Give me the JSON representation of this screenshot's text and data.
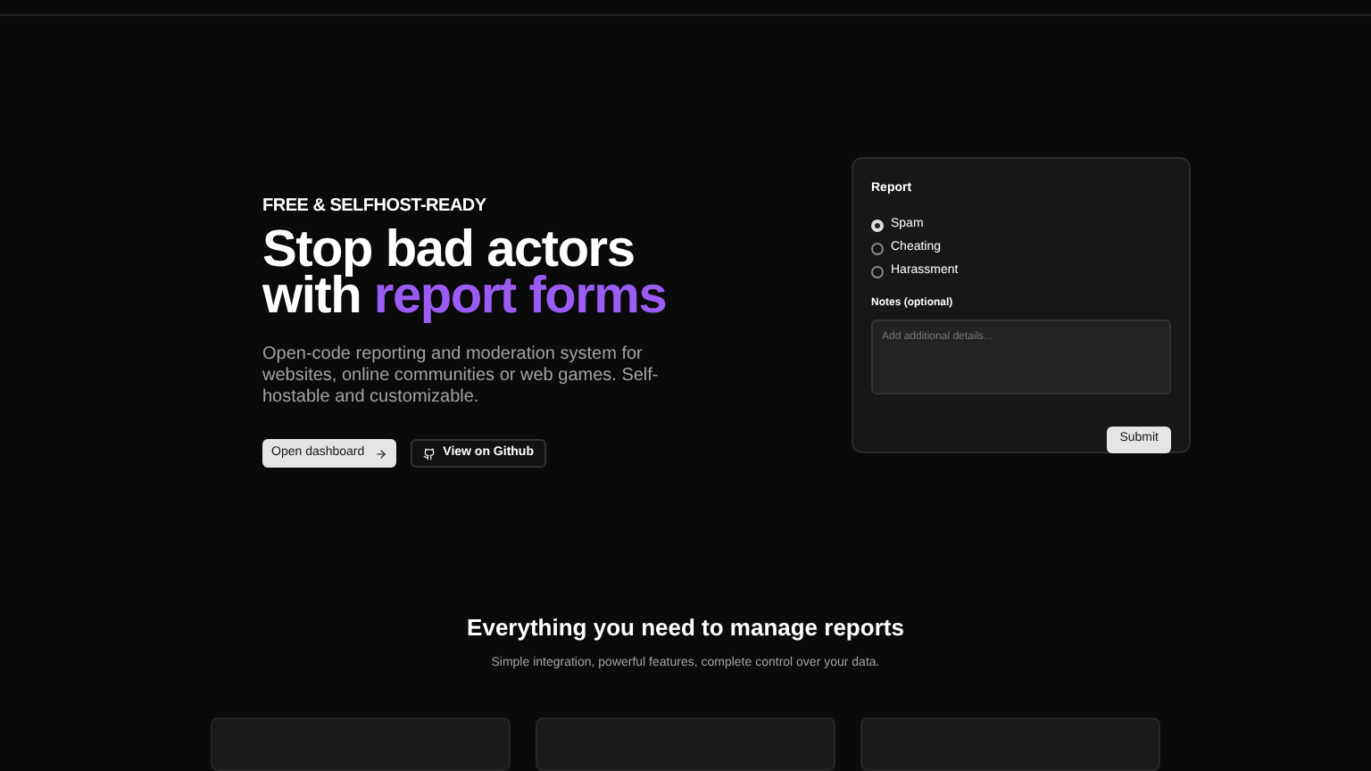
{
  "hero": {
    "eyebrow": "FREE & SELFHOST-READY",
    "title_line1": "Stop bad actors",
    "title_line2_plain": "with ",
    "title_line2_accent": "report forms",
    "description": "Open-code reporting and moderation system for websites, online communities or web games. Self-hostable and customizable.",
    "buttons": [
      {
        "label": "Open dashboard",
        "kind": "primary"
      },
      {
        "label": "View on Github",
        "kind": "secondary"
      }
    ]
  },
  "report_form": {
    "title": "Report",
    "options": [
      {
        "label": "Spam",
        "selected": true
      },
      {
        "label": "Cheating",
        "selected": false
      },
      {
        "label": "Harassment",
        "selected": false
      }
    ],
    "notes_label": "Notes (optional)",
    "notes_placeholder": "Add additional details...",
    "submit": "Submit"
  },
  "features": {
    "title": "Everything you need to manage reports",
    "subtitle": "Simple integration, powerful features, complete control over your data.",
    "cards": [
      {
        "kind": "card"
      },
      {
        "kind": "card"
      },
      {
        "kind": "card"
      }
    ]
  }
}
